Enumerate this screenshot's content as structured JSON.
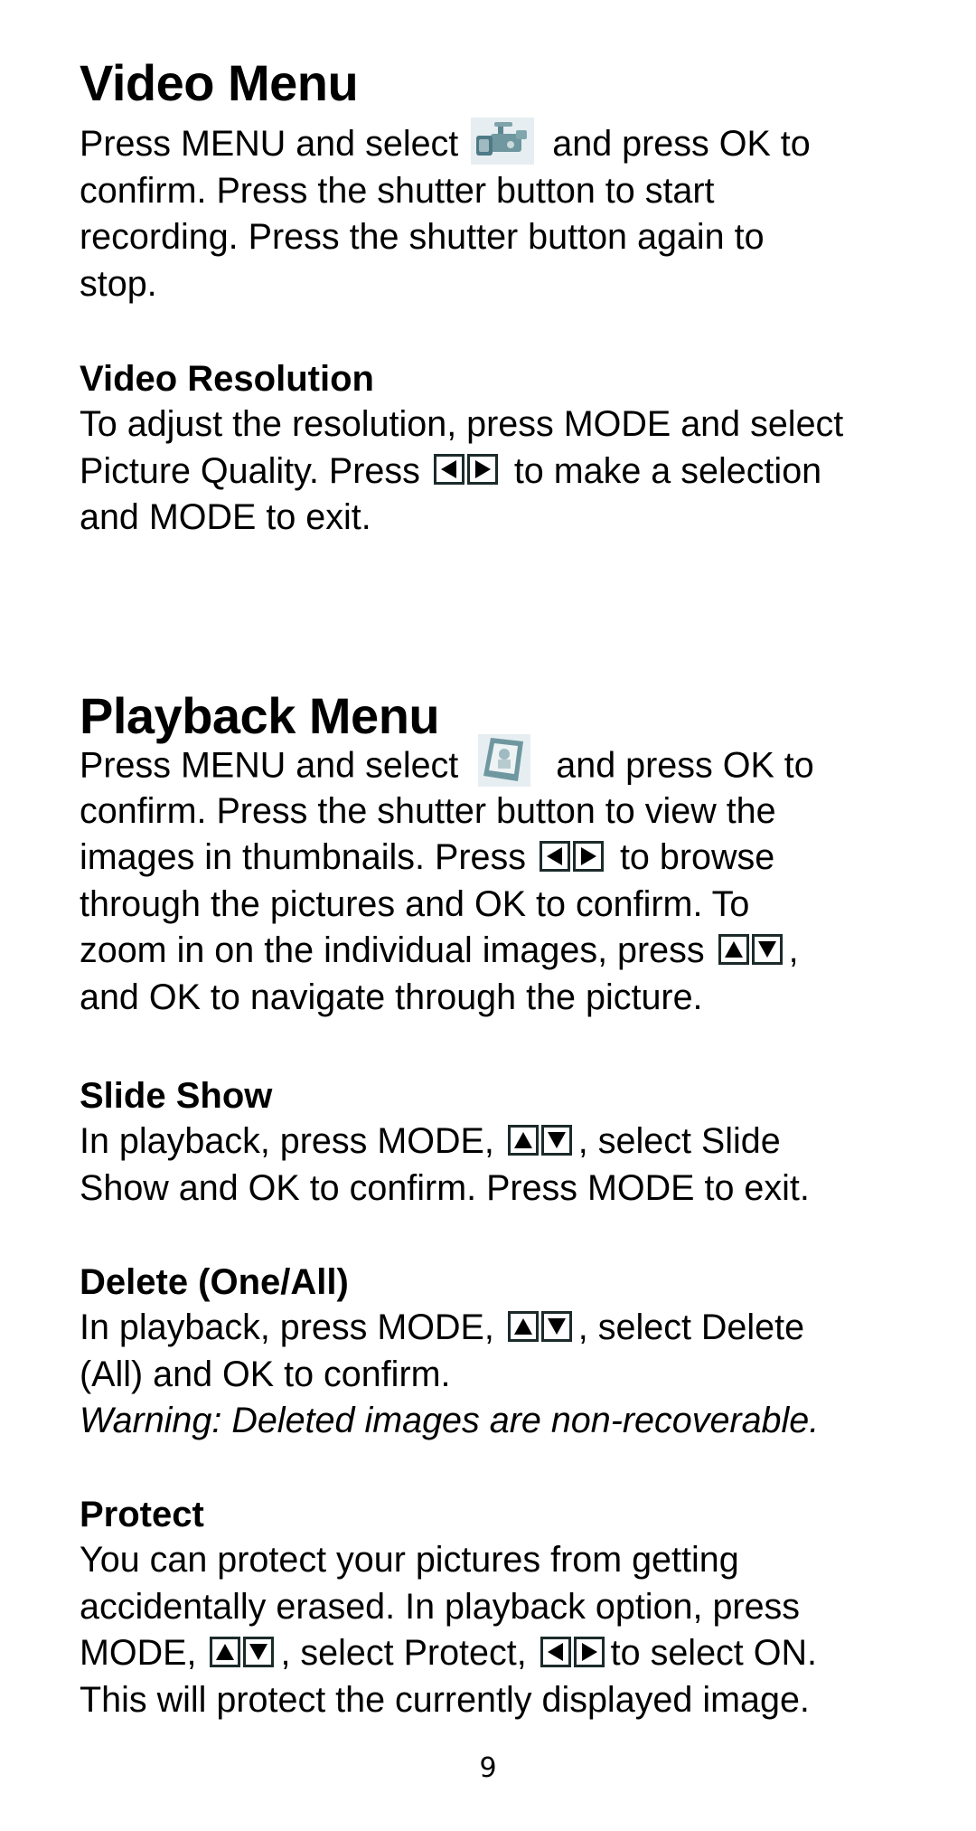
{
  "video_menu": {
    "title": "Video Menu",
    "icon": "video-camera-icon",
    "lines": [
      {
        "before": "Press MENU and select",
        "after": "and press OK to"
      },
      "confirm.  Press the shutter button to start",
      "recording.  Press the shutter button again to",
      "stop."
    ],
    "resolution": {
      "title": "Video Resolution",
      "line1": "To adjust the resolution, press MODE and select",
      "line2_before": "Picture Quality.  Press",
      "line2_after": "to make a selection",
      "line3": "and MODE to exit.",
      "keys": [
        "left-arrow-key-icon",
        "right-arrow-key-icon"
      ]
    }
  },
  "playback_menu": {
    "title": "Playback Menu",
    "icon": "playback-picture-frame-icon",
    "line1_before": "Press MENU and select",
    "line1_after": "and press OK to",
    "line2": "confirm.  Press the shutter button to view the",
    "line3_before": "images in thumbnails.  Press",
    "line3_after": "to browse",
    "line4": "through the pictures and OK to confirm.  To",
    "line5_before": "zoom in on the individual images, press",
    "line5_after": ",",
    "line6": "and OK to navigate through the picture."
  },
  "slide_show": {
    "title": "Slide Show",
    "line1_before": "In playback, press MODE,",
    "line1_after": ", select Slide",
    "line2": "Show and OK to confirm.  Press MODE to exit."
  },
  "delete": {
    "title": "Delete (One/All)",
    "line1_before": "In playback, press MODE,",
    "line1_after": ", select Delete",
    "line2": "(All) and OK to confirm.",
    "warning": "Warning: Deleted images are non-recoverable."
  },
  "protect": {
    "title": "Protect",
    "line1": "You can protect your pictures from getting",
    "line2": "accidentally erased.  In playback option, press",
    "line3_a": "MODE,",
    "line3_b": ", select Protect,",
    "line3_c": "to select ON.",
    "line4": "This will protect the currently displayed image."
  },
  "page_number": "9",
  "colors": {
    "text": "#000000",
    "icon_bg": "#e6eef2",
    "icon_tint": "#5a8a94",
    "key_border": "#1c2a2a"
  }
}
